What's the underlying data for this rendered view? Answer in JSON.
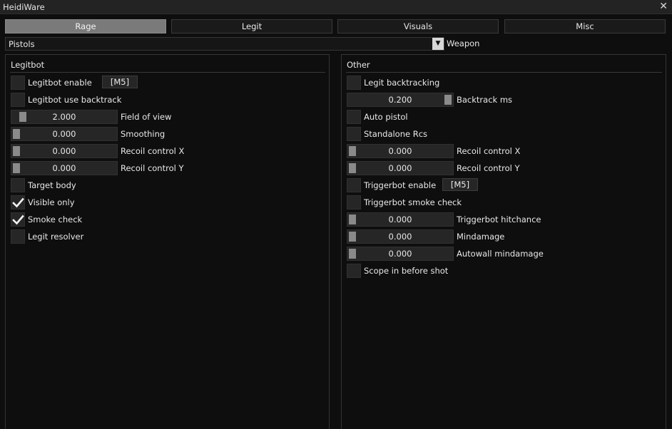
{
  "window": {
    "title": "HeidiWare",
    "close_glyph": "✕"
  },
  "tabs": [
    {
      "label": "Rage",
      "active": true
    },
    {
      "label": "Legit",
      "active": false
    },
    {
      "label": "Visuals",
      "active": false
    },
    {
      "label": "Misc",
      "active": false
    }
  ],
  "weapon": {
    "selected": "Pistols",
    "label": "Weapon",
    "arrow_glyph": "▼"
  },
  "legitbot": {
    "title": "Legitbot",
    "enable": {
      "label": "Legitbot enable",
      "checked": false,
      "key": "[M5]"
    },
    "use_backtrack": {
      "label": "Legitbot use backtrack",
      "checked": false
    },
    "fov": {
      "label": "Field of view",
      "value": "2.000",
      "fraction": 0.07
    },
    "smoothing": {
      "label": "Smoothing",
      "value": "0.000",
      "fraction": 0.0
    },
    "recoil_x": {
      "label": "Recoil control X",
      "value": "0.000",
      "fraction": 0.0
    },
    "recoil_y": {
      "label": "Recoil control Y",
      "value": "0.000",
      "fraction": 0.0
    },
    "target_body": {
      "label": "Target body",
      "checked": false
    },
    "visible_only": {
      "label": "Visible only",
      "checked": true
    },
    "smoke_check": {
      "label": "Smoke check",
      "checked": true
    },
    "legit_resolver": {
      "label": "Legit resolver",
      "checked": false
    }
  },
  "other": {
    "title": "Other",
    "legit_backtracking": {
      "label": "Legit backtracking",
      "checked": false
    },
    "backtrack_ms": {
      "label": "Backtrack ms",
      "value": "0.200",
      "fraction": 1.0
    },
    "auto_pistol": {
      "label": "Auto pistol",
      "checked": false
    },
    "standalone_rcs": {
      "label": "Standalone Rcs",
      "checked": false
    },
    "recoil_x": {
      "label": "Recoil control X",
      "value": "0.000",
      "fraction": 0.0
    },
    "recoil_y": {
      "label": "Recoil control Y",
      "value": "0.000",
      "fraction": 0.0
    },
    "triggerbot_enable": {
      "label": "Triggerbot enable",
      "checked": false,
      "key": "[M5]"
    },
    "triggerbot_smoke": {
      "label": "Triggerbot smoke check",
      "checked": false
    },
    "triggerbot_hitchance": {
      "label": "Triggerbot hitchance",
      "value": "0.000",
      "fraction": 0.0
    },
    "mindamage": {
      "label": "Mindamage",
      "value": "0.000",
      "fraction": 0.0
    },
    "autowall_mindamage": {
      "label": "Autowall mindamage",
      "value": "0.000",
      "fraction": 0.0
    },
    "scope_in": {
      "label": "Scope in before shot",
      "checked": false
    }
  }
}
